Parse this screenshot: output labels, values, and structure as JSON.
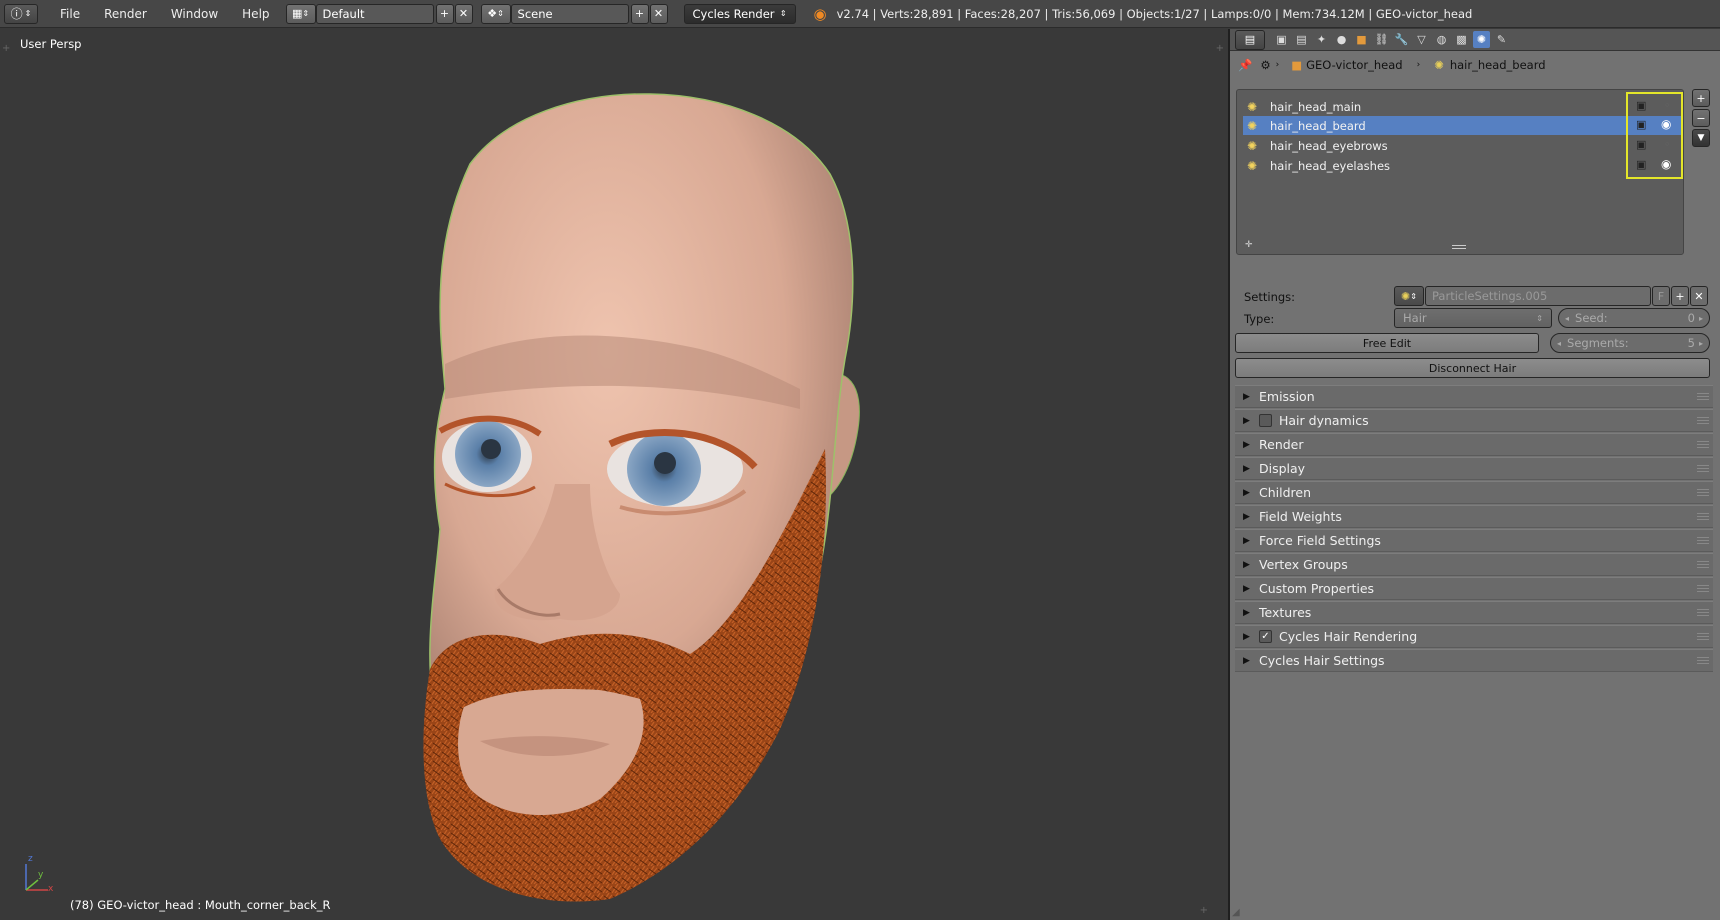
{
  "topbar": {
    "menu": [
      "File",
      "Render",
      "Window",
      "Help"
    ],
    "screen_layout": "Default",
    "scene": "Scene",
    "render_engine": "Cycles Render",
    "stats": "v2.74 | Verts:28,891 | Faces:28,207 | Tris:56,069 | Objects:1/27 | Lamps:0/0 | Mem:734.12M | GEO-victor_head"
  },
  "viewport": {
    "view_label": "User Persp",
    "status": "(78) GEO-victor_head : Mouth_corner_back_R",
    "axes": {
      "x": "x",
      "y": "y",
      "z": "z"
    }
  },
  "properties": {
    "breadcrumb": {
      "object": "GEO-victor_head",
      "particles": "hair_head_beard"
    },
    "particle_systems": [
      {
        "name": "hair_head_main",
        "selected": false,
        "visible": false
      },
      {
        "name": "hair_head_beard",
        "selected": true,
        "visible": true
      },
      {
        "name": "hair_head_eyebrows",
        "selected": false,
        "visible": false
      },
      {
        "name": "hair_head_eyelashes",
        "selected": false,
        "visible": true
      }
    ],
    "settings_label": "Settings:",
    "settings_value": "ParticleSettings.005",
    "settings_flag": "F",
    "type_label": "Type:",
    "type_value": "Hair",
    "seed_label": "Seed:",
    "seed_value": "0",
    "free_edit": "Free Edit",
    "segments_label": "Segments:",
    "segments_value": "5",
    "disconnect": "Disconnect Hair",
    "panels": [
      {
        "label": "Emission",
        "checkbox": null
      },
      {
        "label": "Hair dynamics",
        "checkbox": false
      },
      {
        "label": "Render",
        "checkbox": null
      },
      {
        "label": "Display",
        "checkbox": null
      },
      {
        "label": "Children",
        "checkbox": null
      },
      {
        "label": "Field Weights",
        "checkbox": null
      },
      {
        "label": "Force Field Settings",
        "checkbox": null
      },
      {
        "label": "Vertex Groups",
        "checkbox": null
      },
      {
        "label": "Custom Properties",
        "checkbox": null
      },
      {
        "label": "Textures",
        "checkbox": null
      },
      {
        "label": "Cycles Hair Rendering",
        "checkbox": true
      },
      {
        "label": "Cycles Hair Settings",
        "checkbox": null
      }
    ]
  },
  "colors": {
    "selection": "#5680c2",
    "highlight_box": "#e4e62a",
    "beard": "#a8481a",
    "skin": "#e8b7a1"
  }
}
